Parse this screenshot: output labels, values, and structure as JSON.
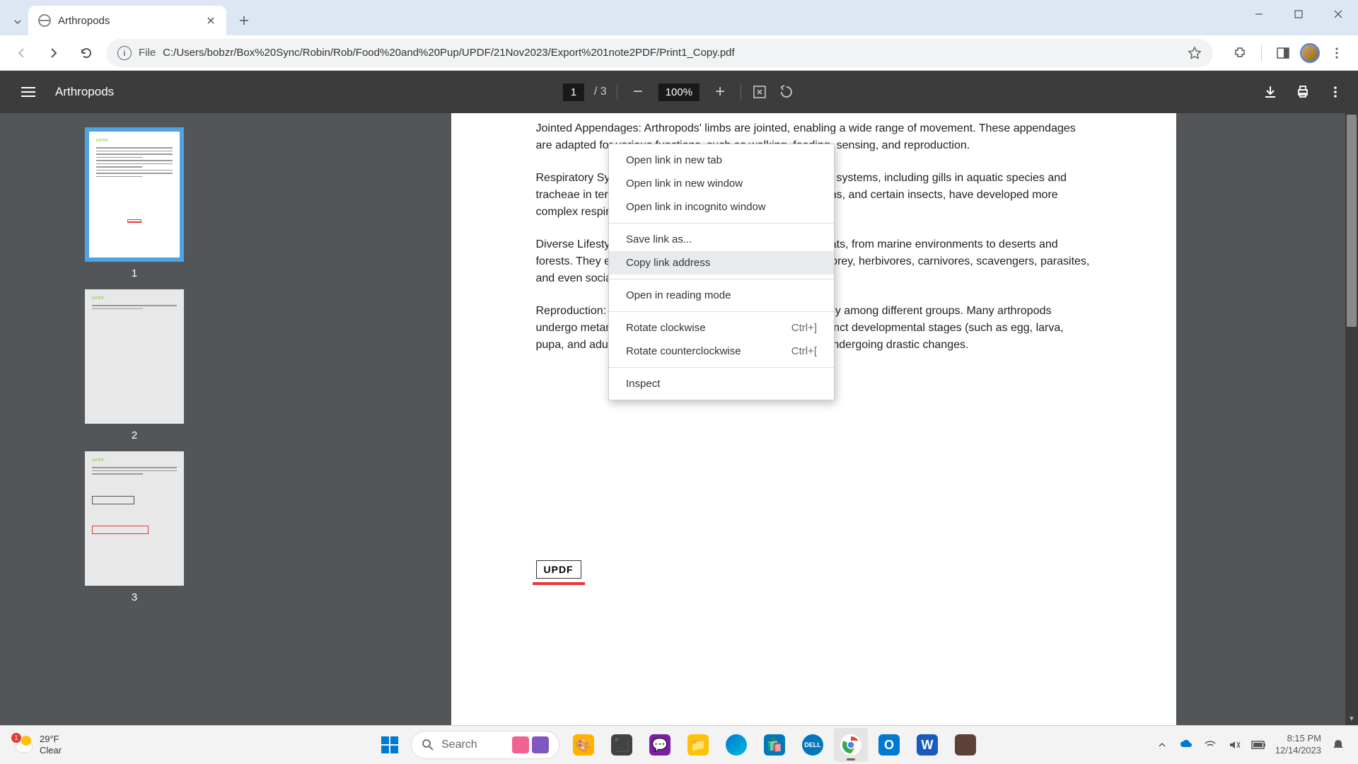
{
  "browser": {
    "tab_title": "Arthropods",
    "url": "C:/Users/bobzr/Box%20Sync/Robin/Rob/Food%20and%20Pup/UPDF/21Nov2023/Export%201note2PDF/Print1_Copy.pdf",
    "file_label": "File"
  },
  "pdf": {
    "title": "Arthropods",
    "page_current": "1",
    "page_total": "/  3",
    "zoom": "100%",
    "thumbs": [
      "1",
      "2",
      "3"
    ],
    "badge": "UPDF",
    "body": {
      "p1": "Jointed Appendages: Arthropods' limbs are jointed, enabling a wide range of movement. These appendages are adapted for various functions, such as walking, feeding, sensing, and reproduction.",
      "p2": "Respiratory Systems: Arthropods exhibit diverse respiratory systems, including gills in aquatic species and tracheae in terrestrial ones. Some, like spiders and scorpions, and certain insects, have developed more complex respiratory structures known as book lungs.",
      "p3": "Diverse Lifestyles: Arthropods inhabit a wide range of habitats, from marine environments to deserts and forests. They exhibit various lifestyles, including predators, prey, herbivores, carnivores, scavengers, parasites, and even social insects like ants and bees.",
      "p4": "Reproduction: Reproduction in arthropods varies significantly among different groups. Many arthropods undergo metamorphosis, where they transition through distinct developmental stages (such as egg, larva, pupa, and adult). Others have direct development without undergoing drastic changes."
    }
  },
  "context_menu": {
    "items": [
      "Open link in new tab",
      "Open link in new window",
      "Open link in incognito window"
    ],
    "save": "Save link as...",
    "copy": "Copy link address",
    "reading": "Open in reading mode",
    "rotate_cw": "Rotate clockwise",
    "rotate_cw_sc": "Ctrl+]",
    "rotate_ccw": "Rotate counterclockwise",
    "rotate_ccw_sc": "Ctrl+[",
    "inspect": "Inspect"
  },
  "taskbar": {
    "weather_badge": "1",
    "weather_temp": "29°F",
    "weather_cond": "Clear",
    "search": "Search",
    "time": "8:15 PM",
    "date": "12/14/2023"
  }
}
